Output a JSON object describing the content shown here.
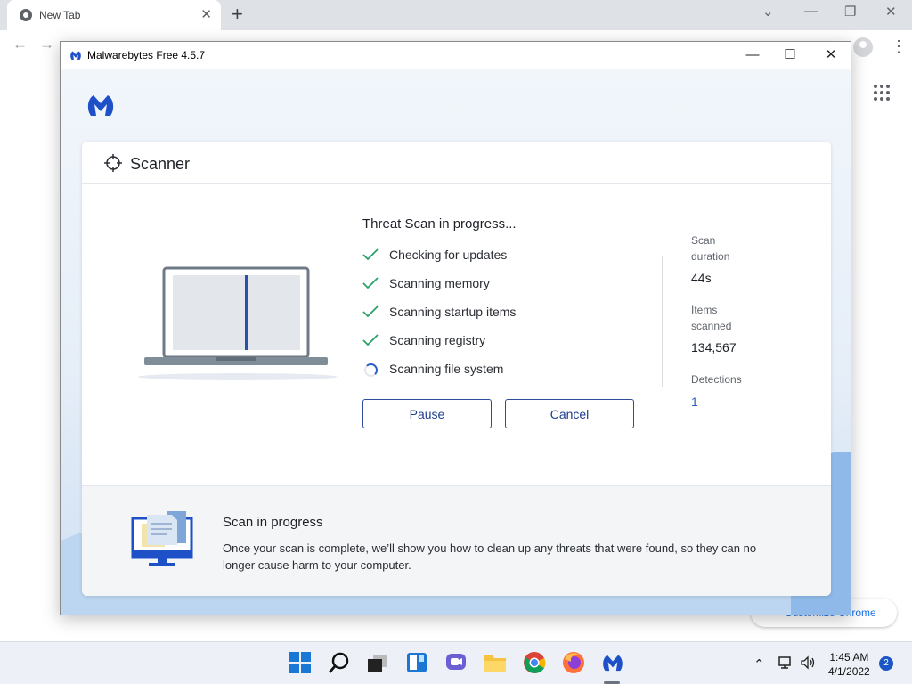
{
  "browser": {
    "tab_title": "New Tab",
    "new_tab_label": "+",
    "customize_label": "Customize Chrome"
  },
  "app": {
    "title": "Malwarebytes Free  4.5.7",
    "brand_color": "#2c5fc4"
  },
  "scanner": {
    "header": "Scanner",
    "scan_title": "Threat Scan in progress...",
    "steps": [
      {
        "label": "Checking for updates",
        "status": "done"
      },
      {
        "label": "Scanning memory",
        "status": "done"
      },
      {
        "label": "Scanning startup items",
        "status": "done"
      },
      {
        "label": "Scanning registry",
        "status": "done"
      },
      {
        "label": "Scanning file system",
        "status": "in-progress"
      }
    ],
    "pause_label": "Pause",
    "cancel_label": "Cancel",
    "stats": {
      "duration_label": "Scan\nduration",
      "duration_value": "44s",
      "items_label": "Items\nscanned",
      "items_value": "134,567",
      "detections_label": "Detections",
      "detections_value": "1"
    },
    "footer": {
      "title": "Scan in progress",
      "body": "Once your scan is complete, we’ll show you how to clean up any threats that were found, so they can no longer cause harm to your computer."
    }
  },
  "taskbar": {
    "apps": [
      "start-icon",
      "search-icon",
      "task-view-icon",
      "widgets-icon",
      "chat-icon",
      "file-explorer-icon",
      "chrome-icon",
      "firefox-icon",
      "malwarebytes-icon"
    ],
    "time": "1:45 AM",
    "date": "4/1/2022",
    "notification_count": "2"
  }
}
